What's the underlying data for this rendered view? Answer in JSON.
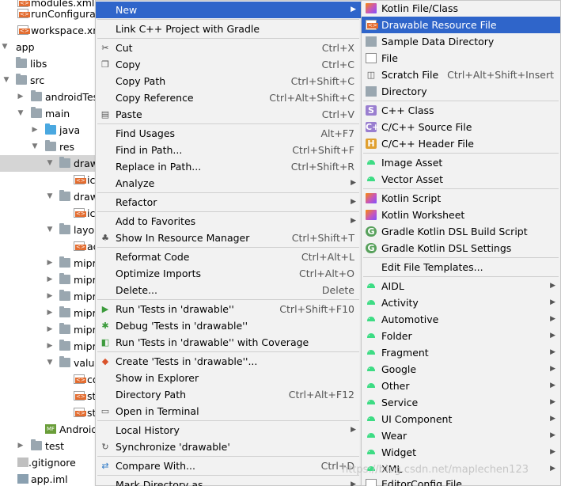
{
  "tree": {
    "rows": [
      {
        "label": "modules.xml",
        "arrow": "",
        "icon": "xml"
      },
      {
        "label": "runConfigurat",
        "arrow": "",
        "icon": "xml"
      },
      {
        "label": "workspace.xm",
        "arrow": "",
        "icon": "xml"
      },
      {
        "label": "app",
        "arrow": "▼",
        "icon": "folder"
      },
      {
        "label": "libs",
        "arrow": "",
        "icon": "folder"
      },
      {
        "label": "src",
        "arrow": "▼",
        "icon": "folder"
      },
      {
        "label": "androidTes",
        "arrow": "▶",
        "icon": "folder"
      },
      {
        "label": "main",
        "arrow": "▼",
        "icon": "folder"
      },
      {
        "label": "java",
        "arrow": "▶",
        "icon": "folder-blue"
      },
      {
        "label": "res",
        "arrow": "▼",
        "icon": "folder"
      },
      {
        "label": "draw",
        "arrow": "▼",
        "icon": "folder"
      },
      {
        "label": "ic",
        "arrow": "",
        "icon": "xml"
      },
      {
        "label": "draw",
        "arrow": "▼",
        "icon": "folder"
      },
      {
        "label": "ic",
        "arrow": "",
        "icon": "xml"
      },
      {
        "label": "layou",
        "arrow": "▼",
        "icon": "folder"
      },
      {
        "label": "ac",
        "arrow": "",
        "icon": "xml"
      },
      {
        "label": "mipr",
        "arrow": "▶",
        "icon": "folder"
      },
      {
        "label": "mipr",
        "arrow": "▶",
        "icon": "folder"
      },
      {
        "label": "mipr",
        "arrow": "▶",
        "icon": "folder"
      },
      {
        "label": "mipr",
        "arrow": "▶",
        "icon": "folder"
      },
      {
        "label": "mipr",
        "arrow": "▶",
        "icon": "folder"
      },
      {
        "label": "mipr",
        "arrow": "▶",
        "icon": "folder"
      },
      {
        "label": "value",
        "arrow": "▼",
        "icon": "folder"
      },
      {
        "label": "co",
        "arrow": "",
        "icon": "xml"
      },
      {
        "label": "st",
        "arrow": "",
        "icon": "xml"
      },
      {
        "label": "st",
        "arrow": "",
        "icon": "xml"
      },
      {
        "label": "Android",
        "arrow": "",
        "icon": "mf"
      },
      {
        "label": "test",
        "arrow": "▶",
        "icon": "folder"
      },
      {
        "label": ".gitignore",
        "arrow": "",
        "icon": "git"
      },
      {
        "label": "app.iml",
        "arrow": "",
        "icon": "iml"
      }
    ]
  },
  "menu1": {
    "items": [
      {
        "label": "New",
        "shortcut": "",
        "submenu": true,
        "icon": ""
      },
      {
        "label": "Link C++ Project with Gradle",
        "shortcut": "",
        "submenu": false,
        "icon": ""
      },
      {
        "label": "Cut",
        "shortcut": "Ctrl+X",
        "submenu": false,
        "icon": "cut"
      },
      {
        "label": "Copy",
        "shortcut": "Ctrl+C",
        "submenu": false,
        "icon": "copy"
      },
      {
        "label": "Copy Path",
        "shortcut": "Ctrl+Shift+C",
        "submenu": false,
        "icon": ""
      },
      {
        "label": "Copy Reference",
        "shortcut": "Ctrl+Alt+Shift+C",
        "submenu": false,
        "icon": ""
      },
      {
        "label": "Paste",
        "shortcut": "Ctrl+V",
        "submenu": false,
        "icon": "paste"
      },
      {
        "label": "Find Usages",
        "shortcut": "Alt+F7",
        "submenu": false,
        "icon": ""
      },
      {
        "label": "Find in Path...",
        "shortcut": "Ctrl+Shift+F",
        "submenu": false,
        "icon": ""
      },
      {
        "label": "Replace in Path...",
        "shortcut": "Ctrl+Shift+R",
        "submenu": false,
        "icon": ""
      },
      {
        "label": "Analyze",
        "shortcut": "",
        "submenu": true,
        "icon": ""
      },
      {
        "label": "Refactor",
        "shortcut": "",
        "submenu": true,
        "icon": ""
      },
      {
        "label": "Add to Favorites",
        "shortcut": "",
        "submenu": true,
        "icon": ""
      },
      {
        "label": "Show In Resource Manager",
        "shortcut": "Ctrl+Shift+T",
        "submenu": false,
        "icon": "resmgr"
      },
      {
        "label": "Reformat Code",
        "shortcut": "Ctrl+Alt+L",
        "submenu": false,
        "icon": ""
      },
      {
        "label": "Optimize Imports",
        "shortcut": "Ctrl+Alt+O",
        "submenu": false,
        "icon": ""
      },
      {
        "label": "Delete...",
        "shortcut": "Delete",
        "submenu": false,
        "icon": ""
      },
      {
        "label": "Run 'Tests in 'drawable''",
        "shortcut": "Ctrl+Shift+F10",
        "submenu": false,
        "icon": "run"
      },
      {
        "label": "Debug 'Tests in 'drawable''",
        "shortcut": "",
        "submenu": false,
        "icon": "debug"
      },
      {
        "label": "Run 'Tests in 'drawable'' with Coverage",
        "shortcut": "",
        "submenu": false,
        "icon": "coverage"
      },
      {
        "label": "Create 'Tests in 'drawable''...",
        "shortcut": "",
        "submenu": false,
        "icon": "create"
      },
      {
        "label": "Show in Explorer",
        "shortcut": "",
        "submenu": false,
        "icon": ""
      },
      {
        "label": "Directory Path",
        "shortcut": "Ctrl+Alt+F12",
        "submenu": false,
        "icon": ""
      },
      {
        "label": "Open in Terminal",
        "shortcut": "",
        "submenu": false,
        "icon": "terminal"
      },
      {
        "label": "Local History",
        "shortcut": "",
        "submenu": true,
        "icon": ""
      },
      {
        "label": "Synchronize 'drawable'",
        "shortcut": "",
        "submenu": false,
        "icon": "sync"
      },
      {
        "label": "Compare With...",
        "shortcut": "Ctrl+D",
        "submenu": false,
        "icon": "compare"
      },
      {
        "label": "Mark Directory as",
        "shortcut": "",
        "submenu": true,
        "icon": ""
      }
    ]
  },
  "menu2": {
    "items": [
      {
        "label": "Kotlin File/Class",
        "shortcut": "",
        "submenu": false,
        "icon": "kt"
      },
      {
        "label": "Drawable Resource File",
        "shortcut": "",
        "submenu": false,
        "icon": "xmlres"
      },
      {
        "label": "Sample Data Directory",
        "shortcut": "",
        "submenu": false,
        "icon": "dir"
      },
      {
        "label": "File",
        "shortcut": "",
        "submenu": false,
        "icon": "file"
      },
      {
        "label": "Scratch File",
        "shortcut": "Ctrl+Alt+Shift+Insert",
        "submenu": false,
        "icon": "scratch"
      },
      {
        "label": "Directory",
        "shortcut": "",
        "submenu": false,
        "icon": "dir"
      },
      {
        "label": "C++ Class",
        "shortcut": "",
        "submenu": false,
        "icon": "c"
      },
      {
        "label": "C/C++ Source File",
        "shortcut": "",
        "submenu": false,
        "icon": "cpp"
      },
      {
        "label": "C/C++ Header File",
        "shortcut": "",
        "submenu": false,
        "icon": "h"
      },
      {
        "label": "Image Asset",
        "shortcut": "",
        "submenu": false,
        "icon": "android"
      },
      {
        "label": "Vector Asset",
        "shortcut": "",
        "submenu": false,
        "icon": "android"
      },
      {
        "label": "Kotlin Script",
        "shortcut": "",
        "submenu": false,
        "icon": "kt"
      },
      {
        "label": "Kotlin Worksheet",
        "shortcut": "",
        "submenu": false,
        "icon": "kt"
      },
      {
        "label": "Gradle Kotlin DSL Build Script",
        "shortcut": "",
        "submenu": false,
        "icon": "g"
      },
      {
        "label": "Gradle Kotlin DSL Settings",
        "shortcut": "",
        "submenu": false,
        "icon": "g"
      },
      {
        "label": "Edit File Templates...",
        "shortcut": "",
        "submenu": false,
        "icon": ""
      },
      {
        "label": "AIDL",
        "shortcut": "",
        "submenu": true,
        "icon": "android"
      },
      {
        "label": "Activity",
        "shortcut": "",
        "submenu": true,
        "icon": "android"
      },
      {
        "label": "Automotive",
        "shortcut": "",
        "submenu": true,
        "icon": "android"
      },
      {
        "label": "Folder",
        "shortcut": "",
        "submenu": true,
        "icon": "android"
      },
      {
        "label": "Fragment",
        "shortcut": "",
        "submenu": true,
        "icon": "android"
      },
      {
        "label": "Google",
        "shortcut": "",
        "submenu": true,
        "icon": "android"
      },
      {
        "label": "Other",
        "shortcut": "",
        "submenu": true,
        "icon": "android"
      },
      {
        "label": "Service",
        "shortcut": "",
        "submenu": true,
        "icon": "android"
      },
      {
        "label": "UI Component",
        "shortcut": "",
        "submenu": true,
        "icon": "android"
      },
      {
        "label": "Wear",
        "shortcut": "",
        "submenu": true,
        "icon": "android"
      },
      {
        "label": "Widget",
        "shortcut": "",
        "submenu": true,
        "icon": "android"
      },
      {
        "label": "XML",
        "shortcut": "",
        "submenu": true,
        "icon": "android"
      },
      {
        "label": "EditorConfig File",
        "shortcut": "",
        "submenu": false,
        "icon": "file"
      }
    ]
  },
  "watermark": "https://blog.csdn.net/maplechen123",
  "colors": {
    "highlight": "#2f65ca",
    "menu_bg": "#f2f2f2",
    "selected_row": "#d5d5d5",
    "android_green": "#3ddc84"
  }
}
